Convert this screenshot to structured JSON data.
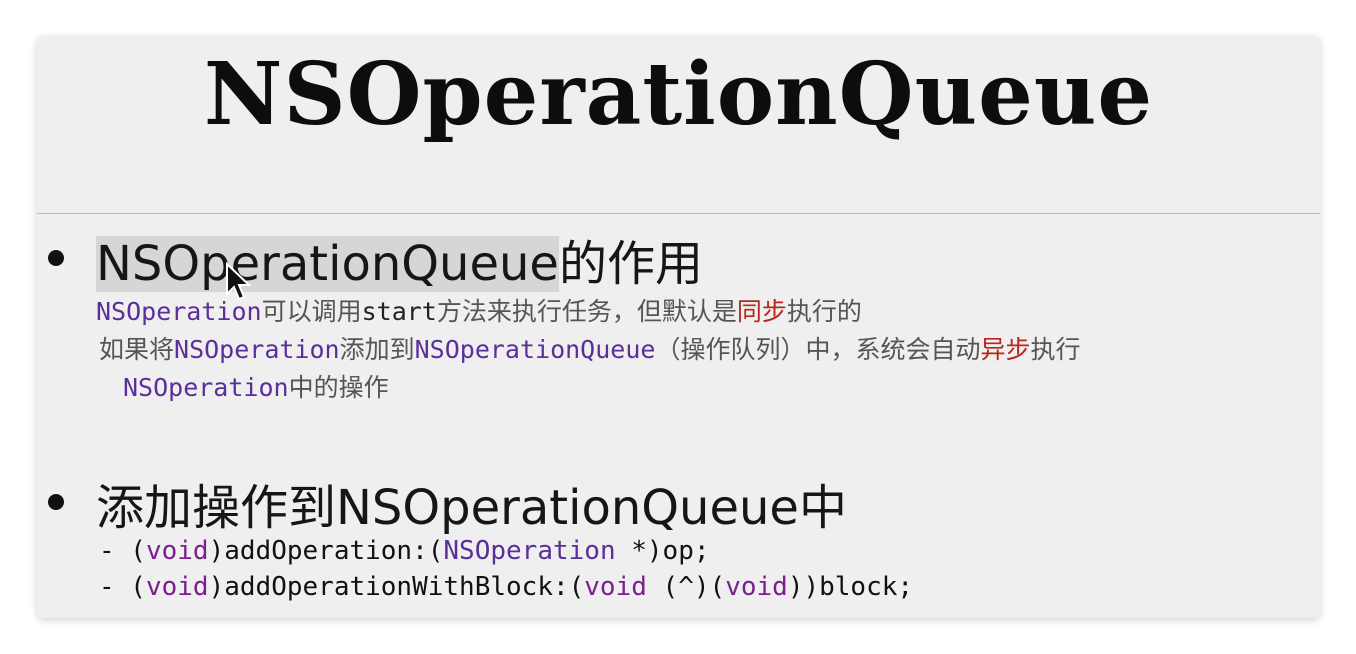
{
  "slide": {
    "title": "NSOperationQueue",
    "section1": {
      "heading_highlight": "NSOperationQueue",
      "heading_rest": "的作用",
      "line1": {
        "class1": "NSOperation",
        "text1": "可以调用",
        "method": "start",
        "text2": "方法来执行任务，但默认是",
        "red": "同步",
        "text3": "执行的"
      },
      "line2": {
        "text1": "如果将",
        "class1": "NSOperation",
        "text2": "添加到",
        "class2": "NSOperationQueue",
        "text3": "（操作队列）中，系统会自动",
        "red": "异步",
        "text4": "执行"
      },
      "line3": {
        "class1": "NSOperation",
        "text1": "中的操作"
      }
    },
    "section2": {
      "heading": "添加操作到NSOperationQueue中",
      "code1": {
        "prefix": "- (",
        "kw1": "void",
        "mid": ")addOperation:(",
        "cls": "NSOperation",
        "suffix": " *)op;"
      },
      "code2": {
        "prefix": "- (",
        "kw1": "void",
        "mid": ")addOperationWithBlock:(",
        "kw2": "void",
        "mid2": " (^)(",
        "kw3": "void",
        "suffix": "))block;"
      }
    }
  },
  "colors": {
    "keyword": "#7a1f8f",
    "class": "#5a2f9a",
    "emphasis": "#b7271b"
  },
  "icons": [
    "mouse-pointer-icon",
    "bullet-icon"
  ]
}
